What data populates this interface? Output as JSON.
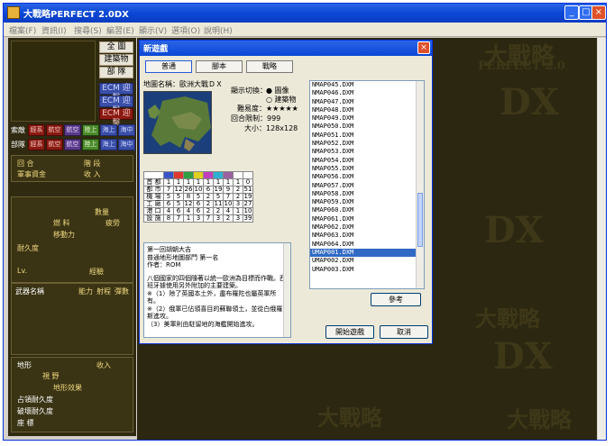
{
  "window": {
    "title": "大戰略PERFECT 2.0DX"
  },
  "menu": [
    "檔案(F)",
    "資訊(I)",
    "搜尋(S)",
    "編習(E)",
    "顯示(V)",
    "選項(O)",
    "說明(H)"
  ],
  "left_panel": {
    "view_buttons": [
      "全 圖",
      "建築物",
      "部 隊"
    ],
    "ecm_buttons": [
      "ECM 迎擊",
      "ECM 迎擊",
      "ECM 迎擊"
    ],
    "row1_label": "索敵",
    "row1_buttons": [
      "經系",
      "航空",
      "航空",
      "陸上",
      "海上",
      "海中"
    ],
    "row2_label": "部隊",
    "row2_buttons": [
      "經系",
      "航空",
      "航空",
      "陸上",
      "海上",
      "海中"
    ],
    "turn_label": "回 合",
    "phase_label": "階 段",
    "funds_label": "軍事資金",
    "income_label": "收 入",
    "count_label": "數量",
    "fuel_label": "燃 料",
    "fatigue_label": "疲勞",
    "move_label": "移動力",
    "durability_label": "耐久度",
    "lv_label": "Lv.",
    "experience_label": "經驗",
    "weapon_headers": [
      "武器名稱",
      "能力",
      "射程",
      "彈數"
    ],
    "terrain_label": "地形",
    "terrain_value": "收入",
    "field_label": "視 野",
    "terrain_effect_label": "地形效果",
    "occupied_label": "占領耐久度",
    "destroy_label": "破壞耐久度",
    "coord_label": "座 標"
  },
  "dialog": {
    "title": "新遊戲",
    "tabs": [
      "普通",
      "腳本",
      "戰略"
    ],
    "map_name_label": "地圖名稱：歐洲大戰ＤＸ",
    "display_switch_label": "顯示切換：",
    "display_options": [
      "圖像",
      "建築物"
    ],
    "difficulty_label": "難易度：★★★★★",
    "turn_limit_label": "回合限制：999",
    "size_label": "大小：128x128",
    "stats_colors": [
      "#3a54c8",
      "#e03a30",
      "#30a040",
      "#e0d020",
      "#c040c0",
      "#30b0d0",
      "#9a60a0",
      "#ffffff"
    ],
    "stats_rows": [
      {
        "label": "首 都",
        "values": [
          "1",
          "1",
          "1",
          "1",
          "1",
          "1",
          "1",
          "1",
          "0"
        ]
      },
      {
        "label": "都 市",
        "values": [
          "7",
          "12",
          "26",
          "10",
          "6",
          "19",
          "9",
          "2",
          "51"
        ]
      },
      {
        "label": "機 場",
        "values": [
          "5",
          "5",
          "8",
          "5",
          "2",
          "5",
          "7",
          "2",
          "19"
        ]
      },
      {
        "label": "工 廠",
        "values": [
          "6",
          "5",
          "12",
          "6",
          "2",
          "11",
          "10",
          "3",
          "27"
        ]
      },
      {
        "label": "港 口",
        "values": [
          "4",
          "6",
          "4",
          "6",
          "2",
          "2",
          "4",
          "1",
          "10"
        ]
      },
      {
        "label": "設 施",
        "values": [
          "8",
          "7",
          "1",
          "3",
          "7",
          "3",
          "2",
          "3",
          "39"
        ]
      }
    ],
    "description": [
      "第一回胡朝大吉",
      "普通地形地圖部門 第一名",
      "作者：ROM",
      "",
      "八個國家的四個隨著以統一歐洲為目標而作戰。西班牙據使用另外附加的主要建築。",
      "※（1）除了英國本土外，盡布羅陀也屬英軍所有。",
      "※（2）俄軍已佔領喜目的蘇聯領土，並從白俄羅斯進攻。",
      "（3）美軍則由駐留地的海艦開始進攻。"
    ],
    "files": [
      "NMAP045.DXM",
      "NMAP046.DXM",
      "NMAP047.DXM",
      "NMAP048.DXM",
      "NMAP049.DXM",
      "NMAP050.DXM",
      "NMAP051.DXM",
      "NMAP052.DXM",
      "NMAP053.DXM",
      "NMAP054.DXM",
      "NMAP055.DXM",
      "NMAP056.DXM",
      "NMAP057.DXM",
      "NMAP058.DXM",
      "NMAP059.DXM",
      "NMAP060.DXM",
      "NMAP061.DXM",
      "NMAP062.DXM",
      "NMAP063.DXM",
      "NMAP064.DXM",
      "UMAP001.DXM",
      "UMAP002.DXM",
      "UMAP003.DXM"
    ],
    "selected_file_index": 20,
    "ref_button": "參考",
    "start_button": "開始遊戲",
    "cancel_button": "取消"
  },
  "watermark": {
    "line1": "大戰略",
    "line2": "PERFECT",
    "line3": "2.0",
    "line4": "DX"
  }
}
